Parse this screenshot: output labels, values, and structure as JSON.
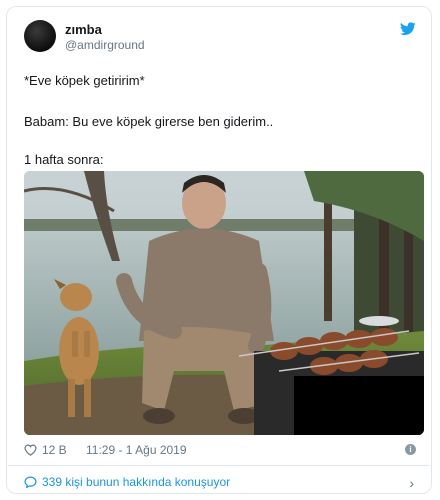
{
  "tweet": {
    "display_name": "zımba",
    "handle": "@amdirground",
    "lines": [
      "*Eve köpek getiririm*",
      "Babam: Bu eve köpek girerse ben giderim..",
      "1 hafta sonra:"
    ],
    "likes": "12 B",
    "timestamp": "11:29 - 1 Ağu 2019",
    "conversation_cta": "339 kişi bunun hakkında konuşuyor"
  },
  "icons": {
    "brand": "twitter-bird-icon",
    "like": "heart-icon",
    "info": "info-icon",
    "reply": "speech-bubble-icon",
    "more": "chevron-right-icon"
  },
  "colors": {
    "link": "#1b95e0",
    "muted": "#657786",
    "border": "#e1e8ed",
    "brand_blue": "#1da1f2"
  }
}
